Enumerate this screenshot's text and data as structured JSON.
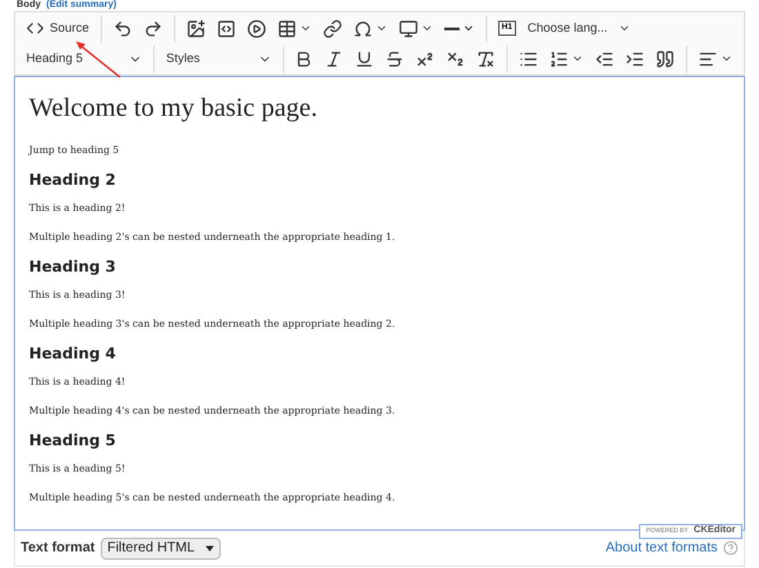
{
  "field_label": {
    "name": "Body",
    "link": "(Edit summary)"
  },
  "toolbar": {
    "source": "Source",
    "heading": "Heading 5",
    "styles": "Styles",
    "language": "Choose lang...",
    "heading_tag": "H1"
  },
  "content": [
    {
      "kind": "title",
      "text": "Welcome to my basic page."
    },
    {
      "kind": "paragraph",
      "text": "Jump to heading 5"
    },
    {
      "kind": "heading",
      "text": "Heading 2"
    },
    {
      "kind": "paragraph",
      "text": "This is a heading 2!"
    },
    {
      "kind": "paragraph",
      "text": "Multiple heading 2's can be nested underneath the appropriate heading 1."
    },
    {
      "kind": "heading",
      "text": "Heading 3"
    },
    {
      "kind": "paragraph",
      "text": "This is a heading 3!"
    },
    {
      "kind": "paragraph",
      "text": "Multiple heading 3's can be nested underneath the appropriate heading 2."
    },
    {
      "kind": "heading",
      "text": "Heading 4"
    },
    {
      "kind": "paragraph",
      "text": "This is a heading 4!"
    },
    {
      "kind": "paragraph",
      "text": "Multiple heading 4's can be nested underneath the appropriate heading 3."
    },
    {
      "kind": "heading",
      "text": "Heading 5"
    },
    {
      "kind": "paragraph",
      "text": "This is a heading 5!"
    },
    {
      "kind": "paragraph",
      "text": "Multiple heading 5's can be nested underneath the appropriate heading 4."
    }
  ],
  "badge": {
    "prefix": "POWERED BY",
    "brand": "CKEditor"
  },
  "footer": {
    "label": "Text format",
    "format": "Filtered HTML",
    "link": "About text formats"
  }
}
